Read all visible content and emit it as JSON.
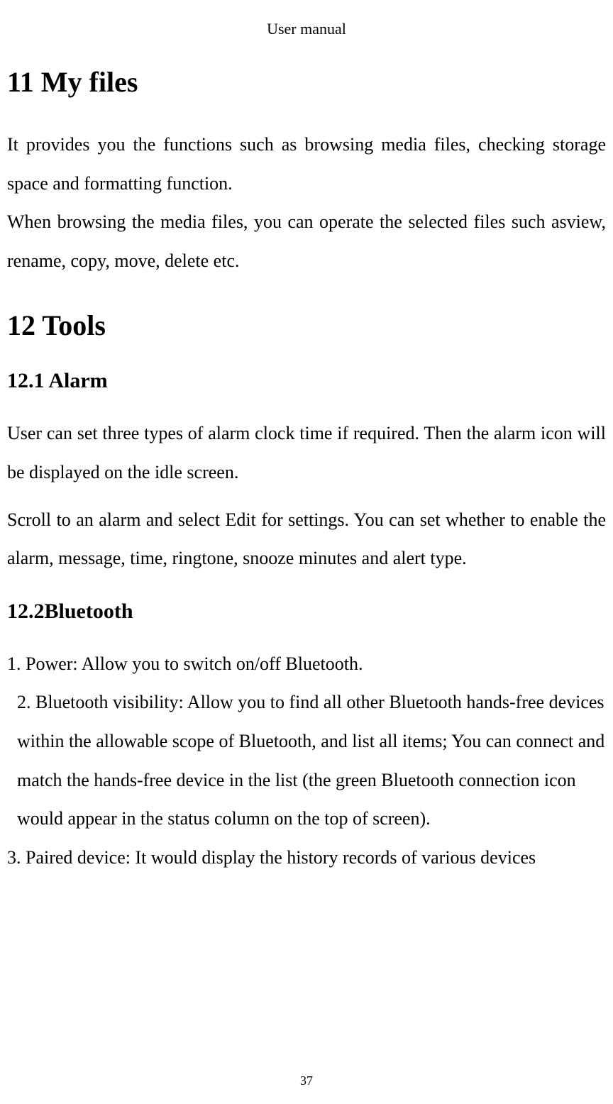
{
  "header": {
    "title": "User manual"
  },
  "sections": {
    "s11": {
      "heading": "11 My files",
      "p1": "It provides you the functions such as browsing media files, checking storage space and formatting function.",
      "p2": "When browsing the media files, you can operate the selected files such asview, rename, copy, move, delete etc."
    },
    "s12": {
      "heading": "12 Tools",
      "sub1": {
        "heading": "12.1 Alarm",
        "p1": "User can set three types of alarm clock time if required. Then the alarm icon will be displayed on the idle screen.",
        "p2": "Scroll to an alarm and select Edit for settings. You can set whether to enable the alarm, message, time, ringtone, snooze minutes and alert type."
      },
      "sub2": {
        "heading": "12.2Bluetooth",
        "p1": "1. Power: Allow you to switch on/off Bluetooth.",
        "p2": "2. Bluetooth visibility: Allow you to find all other Bluetooth hands-free devices within the allowable scope of Bluetooth, and list all items; You can connect and match the hands-free device in the list (the green Bluetooth connection icon would appear in the status column on the top of screen).",
        "p3": "3. Paired device: It would display the history records of various devices"
      }
    }
  },
  "footer": {
    "page": "37"
  }
}
